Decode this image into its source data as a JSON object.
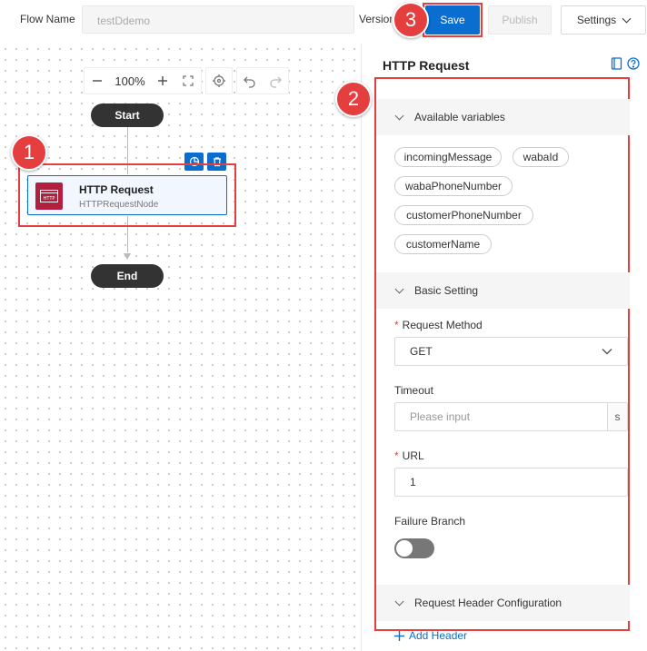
{
  "header": {
    "flow_name_label": "Flow Name",
    "flow_name_value": "testDdemo",
    "version_label": "Version",
    "save_label": "Save",
    "publish_label": "Publish",
    "settings_label": "Settings"
  },
  "canvas": {
    "zoom": "100%",
    "start_label": "Start",
    "end_label": "End",
    "node": {
      "title": "HTTP Request",
      "subtitle": "HTTPRequestNode",
      "icon_text": "HTTP"
    }
  },
  "badges": [
    "1",
    "2",
    "3"
  ],
  "panel": {
    "title": "HTTP Request",
    "available_variables": {
      "title": "Available variables",
      "items": [
        "incomingMessage",
        "wabaId",
        "wabaPhoneNumber",
        "customerPhoneNumber",
        "customerName"
      ]
    },
    "basic_setting": {
      "title": "Basic Setting",
      "request_method_label": "Request Method",
      "request_method_value": "GET",
      "timeout_label": "Timeout",
      "timeout_placeholder": "Please input",
      "timeout_unit": "s",
      "url_label": "URL",
      "url_value": "1",
      "failure_branch_label": "Failure Branch"
    },
    "request_header": {
      "title": "Request Header Configuration",
      "add_label": "Add Header"
    }
  },
  "colors": {
    "primary": "#0a6ed1",
    "annotation_red": "#e53e3e",
    "node_icon": "#b0213f"
  }
}
